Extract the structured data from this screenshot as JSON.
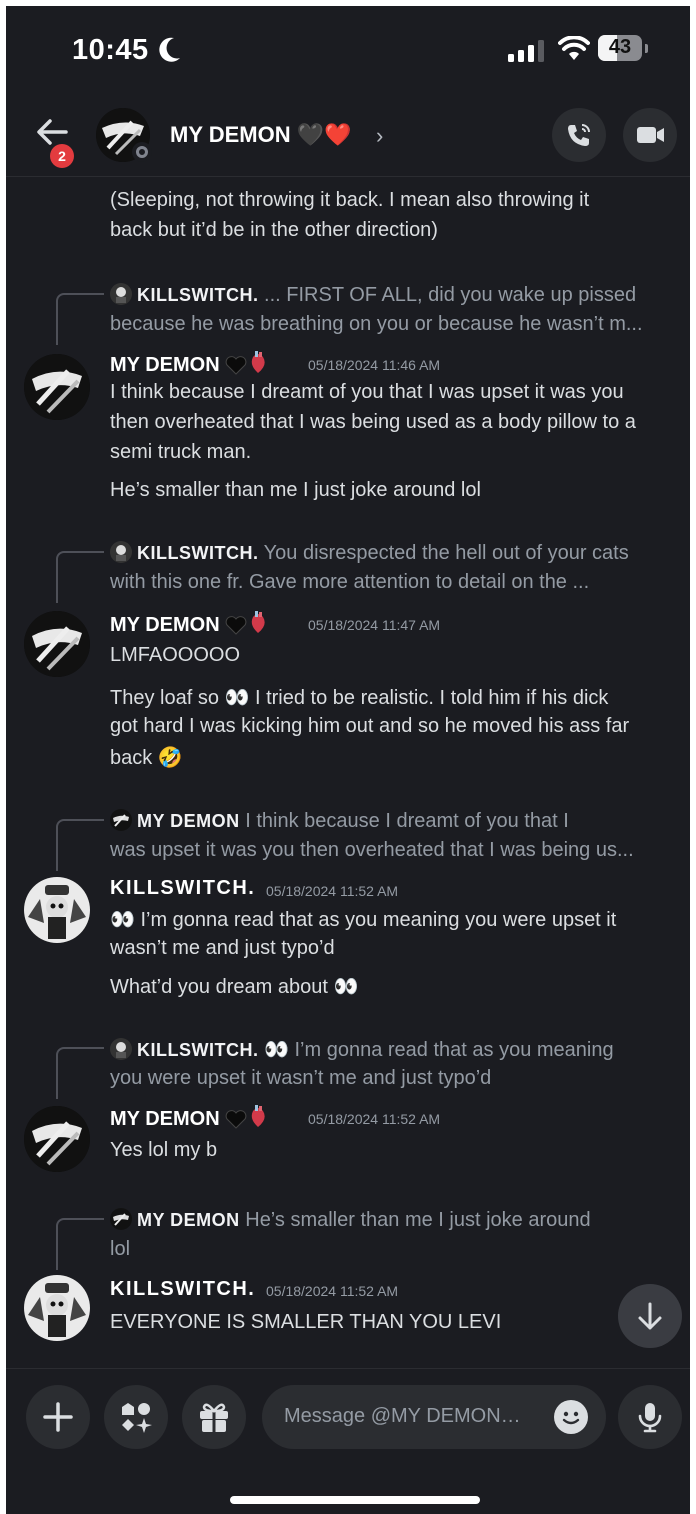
{
  "status_bar": {
    "time": "10:45",
    "battery": "43",
    "battery_level": 0.43
  },
  "header": {
    "title": "MY DEMON 🖤❤️",
    "badge_count": "2",
    "chevron": "›",
    "call_icon": "phone-icon",
    "video_icon": "video-camera-icon"
  },
  "messages": [
    {
      "kind": "continuation",
      "lines": [
        "(Sleeping, not throwing it back. I mean also throwing it",
        "back but it’d be in the other direction)"
      ]
    },
    {
      "reply": {
        "author": "KILLSWITCH.",
        "text": " ... FIRST OF ALL, did you wake up pissed",
        "text2": "because he was breathing on you or because he wasn’t m..."
      },
      "author": "MY DEMON",
      "timestamp": "05/18/2024 11:46 AM",
      "lines": [
        "I think because I dreamt of you that I was upset it was you",
        "then overheated that I was being used as a body pillow to a",
        "semi truck man."
      ],
      "extra": "He’s smaller than me I just joke around lol"
    },
    {
      "reply": {
        "author": "KILLSWITCH.",
        "text": " You disrespected the hell out of your cats",
        "text2": "with this one fr. Gave more attention to detail on the ..."
      },
      "author": "MY DEMON",
      "timestamp": "05/18/2024 11:47 AM",
      "lines": [
        "LMFAOOOOO"
      ],
      "extra_lines": [
        "They loaf so 👀 I tried to be realistic. I told him if his dick",
        "got hard I was kicking him out and so he moved his ass far",
        "back 🤣"
      ]
    },
    {
      "reply": {
        "author": "MY DEMON",
        "text": " I think because I dreamt of you that I",
        "text2": "was upset it was you then overheated that I was being us..."
      },
      "author": "KILLSWITCH.",
      "timestamp": "05/18/2024 11:52 AM",
      "lines": [
        "👀 I’m gonna read that as you meaning you were upset it",
        "wasn’t me and just typo’d"
      ],
      "extra": "What’d you dream about 👀"
    },
    {
      "reply": {
        "author": "KILLSWITCH.",
        "text": " 👀 I’m gonna read that as you meaning",
        "text2": "you were upset it wasn’t me and just typo’d"
      },
      "author": "MY DEMON",
      "timestamp": "05/18/2024 11:52 AM",
      "lines": [
        "Yes lol my b"
      ]
    },
    {
      "reply": {
        "author": "MY DEMON",
        "text": " He’s smaller than me I just joke around",
        "text2": "lol"
      },
      "author": "KILLSWITCH.",
      "timestamp": "05/18/2024 11:52 AM",
      "lines": [
        "EVERYONE IS SMALLER THAN YOU LEVI"
      ]
    }
  ],
  "composer": {
    "placeholder": "Message @MY DEMON…"
  },
  "icons": {
    "add": "plus-icon",
    "apps": "apps-icon",
    "gift": "gift-icon",
    "emoji": "smile-icon",
    "mic": "microphone-icon",
    "scroll": "arrow-down-icon"
  }
}
